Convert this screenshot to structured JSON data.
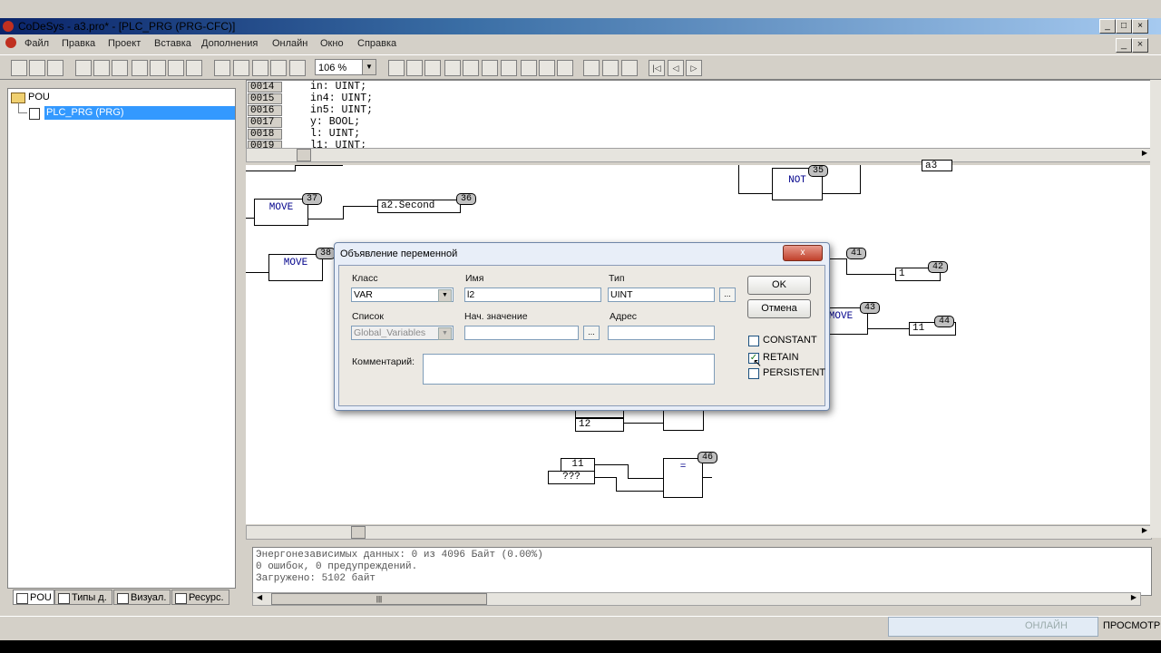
{
  "window": {
    "title": "CoDeSys - a3.pro* - [PLC_PRG (PRG-CFC)]"
  },
  "menu": [
    "Файл",
    "Правка",
    "Проект",
    "Вставка",
    "Дополнения",
    "Онлайн",
    "Окно",
    "Справка"
  ],
  "toolbar": {
    "zoom": "106 %"
  },
  "tree": {
    "root": "POU",
    "selected": "PLC_PRG (PRG)"
  },
  "left_tabs": [
    "POU",
    "Типы д.",
    "Визуал.",
    "Ресурс."
  ],
  "declarations": [
    {
      "line": "0014",
      "code": "in: UINT;"
    },
    {
      "line": "0015",
      "code": "in4: UINT;"
    },
    {
      "line": "0016",
      "code": "in5: UINT;"
    },
    {
      "line": "0017",
      "code": "y: BOOL;"
    },
    {
      "line": "0018",
      "code": "l: UINT;"
    },
    {
      "line": "0019",
      "code": "l1: UINT;"
    }
  ],
  "cfc": {
    "move_a": "MOVE",
    "move_a_num": "37",
    "second_out": "a2.Second",
    "second_num": "36",
    "move_b": "MOVE",
    "move_b_num": "38",
    "not_lbl": "NOT",
    "not_num": "35",
    "a3_out": "a3",
    "move_c_num": "41",
    "out_1": "1",
    "out_1_num": "42",
    "move_d": "MOVE",
    "move_d_num": "43",
    "out_11": "11",
    "out_11_num": "44",
    "in_12": "12",
    "in_11": "11",
    "in_q": "???",
    "eq_lbl": "=",
    "eq_num": "46"
  },
  "messages": [
    "Энергонезависимых данных: 0 из 4096 Байт (0.00%)",
    "0 ошибок, 0 предупреждений.",
    "Загружено: 5102 байт"
  ],
  "status": {
    "online": "ОНЛАЙН",
    "view": "ПРОСМОТР"
  },
  "dialog": {
    "title": "Объявление переменной",
    "close": "x",
    "class_label": "Класс",
    "class_value": "VAR",
    "name_label": "Имя",
    "name_value": "l2",
    "type_label": "Тип",
    "type_value": "UINT",
    "list_label": "Список",
    "list_value": "Global_Variables",
    "init_label": "Нач. значение",
    "init_value": "",
    "addr_label": "Адрес",
    "addr_value": "",
    "comment_label": "Комментарий:",
    "comment_value": "",
    "ok": "OK",
    "cancel": "Отмена",
    "constant": "CONSTANT",
    "retain": "RETAIN",
    "persistent": "PERSISTENT",
    "constant_checked": false,
    "retain_checked": true,
    "persistent_checked": false,
    "ellipsis": "..."
  }
}
